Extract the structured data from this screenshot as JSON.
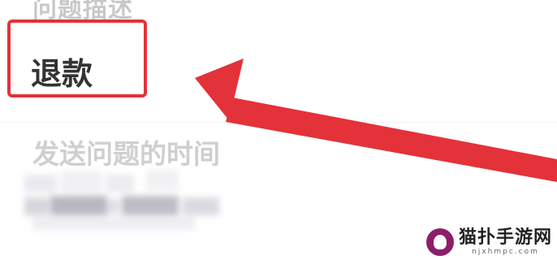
{
  "problem_section": {
    "label": "问题描述",
    "value": "退款"
  },
  "time_section": {
    "label": "发送问题的时间",
    "value_redacted": true
  },
  "annotation": {
    "highlight_color": "#e3323a",
    "arrow_color": "#e3323a",
    "arrow_direction": "pointing-left-toward-value"
  },
  "watermark": {
    "name": "猫扑手游网",
    "url": "njxhmpc.com",
    "logo_color": "#8d1e6a"
  }
}
